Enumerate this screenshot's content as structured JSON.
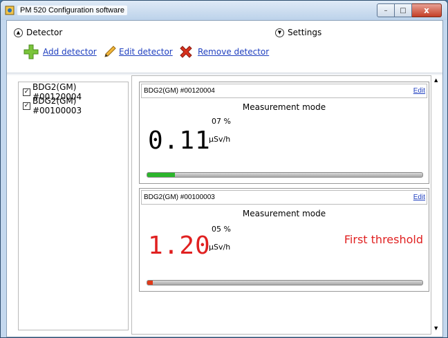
{
  "window": {
    "title": "PM 520 Configuration software",
    "controls": {
      "minimize": "–",
      "maximize": "□",
      "close": "x"
    }
  },
  "sections": {
    "detector_label": "Detector",
    "settings_label": "Settings"
  },
  "toolbar": {
    "add_label": "Add detector",
    "edit_label": "Edit detector",
    "remove_label": "Remove detector"
  },
  "detector_list": [
    {
      "label": "BDG2(GM) #00120004",
      "checked": true
    },
    {
      "label": "BDG2(GM) #00100003",
      "checked": true
    }
  ],
  "detectors": [
    {
      "name": "BDG2(GM) #00120004",
      "edit_label": "Edit",
      "mode": "Measurement mode",
      "value": "0.11",
      "value_color": "#000000",
      "small_value": "07 %",
      "unit": "µSv/h",
      "status": "",
      "progress": 0.1,
      "progress_color": "#2bb52b"
    },
    {
      "name": "BDG2(GM) #00100003",
      "edit_label": "Edit",
      "mode": "Measurement mode",
      "value": "1.20",
      "value_color": "#e02020",
      "small_value": "05 %",
      "unit": "µSv/h",
      "status": "First threshold",
      "progress": 0.02,
      "progress_color": "#e03a1a"
    }
  ],
  "scroll": {
    "up": "▲",
    "down": "▼"
  }
}
